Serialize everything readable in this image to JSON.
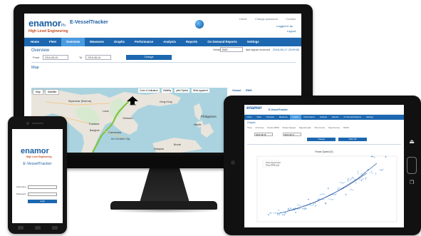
{
  "brand": {
    "logo": "enamor",
    "logo_suffix": "Plc",
    "tagline": "High Level Engineering",
    "app_title": "E-VesselTracker"
  },
  "header_links": [
    "Home",
    "Change password",
    "Contact"
  ],
  "logged_in_as": "Logged in as",
  "logout": "Logout",
  "nav": [
    "Home",
    "Fleet",
    "Overview",
    "Measures",
    "Graphs",
    "Performance",
    "Analysis",
    "Reports",
    "On Demand Reports",
    "Settings"
  ],
  "nav_active": "Overview",
  "overview": {
    "title": "Overview",
    "from_label": "From",
    "from_value": "2016-08-15",
    "to_label": "To",
    "to_value": "2016-08-16",
    "change_button": "Change",
    "vessel_label": "Vessel",
    "vessel_value": "EMS",
    "last_signal_label": "last signal received",
    "last_signal_value": "2016-08-17 23:59:00"
  },
  "map": {
    "title": "Map",
    "type_buttons": [
      "Map",
      "Satellite"
    ],
    "layer_tabs": [
      "Color of Indication",
      "Visibility",
      "pitch Speed",
      "Wind apparent"
    ],
    "labels": [
      "Myanmar (Burma)",
      "Laos",
      "Thailand",
      "Cambodia",
      "Vietnam",
      "Philippines",
      "Bangkok",
      "Hanoi",
      "Hong Kong",
      "Manila",
      "Ho Chi Minh City",
      "Brunei",
      "Malaysia"
    ]
  },
  "side_panel": {
    "vessel_label": "Vessel",
    "vessel_value": "EMS",
    "time_label": "Time stamp",
    "time_value": "2016-08-17 23:59:00"
  },
  "tablet": {
    "nav": [
      "Home",
      "Fleet",
      "Overview",
      "Measures",
      "Graphs",
      "Performance",
      "Analysis",
      "Reports",
      "On Demand Reports",
      "Settings"
    ],
    "nav_active": "Graphs",
    "section": "Graphs",
    "sub_tabs": [
      "Time",
      "Kt-Curve",
      "Power-RPM",
      "Power-Speed",
      "Speed-Load",
      "Trim-Curve",
      "Sea-Curves",
      "SFOC"
    ],
    "from_value": "2016-08-15",
    "to_value": "2016-08-17",
    "change_button": "Change",
    "filter_button": "Filter Off",
    "chart_title": "Power-Speed (E)"
  },
  "chart_data": {
    "type": "scatter",
    "title": "Power-Speed (E)",
    "series": [
      {
        "name": "Power-Speed trend",
        "values": [
          [
            8,
            1200
          ],
          [
            10,
            2000
          ],
          [
            12,
            3100
          ],
          [
            14,
            4600
          ],
          [
            16,
            6500
          ],
          [
            18,
            8900
          ]
        ]
      },
      {
        "name": "Power-RPM trend",
        "values": [
          [
            9,
            1600
          ],
          [
            11,
            2500
          ],
          [
            13,
            3800
          ],
          [
            15,
            5400
          ],
          [
            17,
            7400
          ]
        ]
      }
    ]
  },
  "phone": {
    "logo": "enamor",
    "tagline": "High Level Engineering",
    "title": "E-VesselTracker",
    "user_label": "Username",
    "pass_label": "Password",
    "login_button": "Login"
  }
}
